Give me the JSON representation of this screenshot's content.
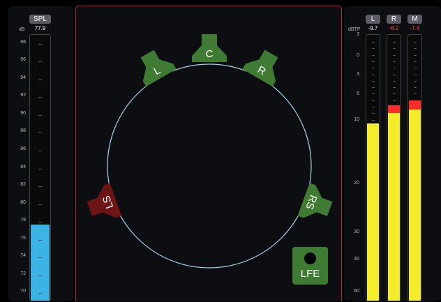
{
  "spl_meter": {
    "tag": "SPL",
    "unit": "dB",
    "readout": "77.9",
    "scale": [
      "98",
      "96",
      "94",
      "92",
      "90",
      "88",
      "86",
      "84",
      "82",
      "80",
      "78",
      "76",
      "74",
      "72",
      "70"
    ],
    "level_db": 77.5,
    "range": [
      69,
      99
    ],
    "fill_color": "#3cb3e5"
  },
  "speakers": {
    "L": "L",
    "C": "C",
    "R": "R",
    "LS": "LS",
    "RS": "RS",
    "LFE": "LFE",
    "active_color": "#3f7b33",
    "alert_color": "#6d1414",
    "circle_color": "#a9d6e8"
  },
  "true_peak_meters": {
    "unit": "dBTP",
    "scale": [
      "3",
      "0",
      "3",
      "6",
      "10",
      "20",
      "30",
      "40",
      "60"
    ],
    "channels": [
      {
        "tag": "L",
        "readout": "-9.7",
        "readout_color": "#ffffff",
        "level_db": -10.5,
        "peak_db": null
      },
      {
        "tag": "R",
        "readout": "-8.2",
        "readout_color": "#ff4b4b",
        "level_db": -8.7,
        "peak_db": -8.2
      },
      {
        "tag": "M",
        "readout": "-7.4",
        "readout_color": "#ff4b4b",
        "level_db": -8.2,
        "peak_db": -7.4
      }
    ],
    "fill_color": "#f4ee2a"
  }
}
